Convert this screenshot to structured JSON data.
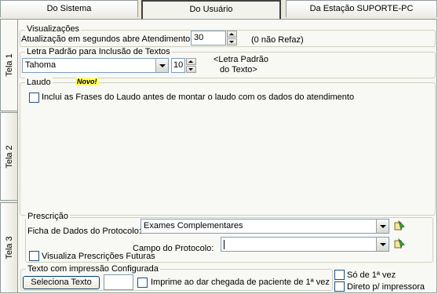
{
  "tabs": [
    {
      "label": "Do Sistema"
    },
    {
      "label": "Do Usuário"
    },
    {
      "label": "Da Estação SUPORTE-PC"
    }
  ],
  "side_tabs": [
    {
      "label": "Tela 1"
    },
    {
      "label": "Tela 2"
    },
    {
      "label": "Tela 3"
    }
  ],
  "visualizacoes": {
    "legend": "Visualizações",
    "label": "Atualização em segundos abre Atendimento:",
    "value": "30",
    "hint": "(0 não Refaz)"
  },
  "letra": {
    "legend": "Letra Padrão para Inclusão de Textos",
    "font_value": "Tahoma",
    "size_value": "10",
    "hint_line1": "<Letra Padrão",
    "hint_line2": "do Texto>"
  },
  "laudo": {
    "legend": "Laudo",
    "badge": "Novo!",
    "checkbox_label": "Inclui as Frases do Laudo antes de montar o laudo com os dados do atendimento"
  },
  "prescricao": {
    "legend": "Prescrição",
    "ficha_label": "Ficha de Dados do Protocolo:",
    "ficha_value": "Exames Complementares",
    "campo_label": "Campo do Protocolo:",
    "campo_value": "",
    "checkbox_label": "Visualiza Prescrições Futuras"
  },
  "impressao": {
    "legend": "Texto com impressão Configurada",
    "button_label": "Seleciona Texto",
    "text_value": "",
    "imprime_label": "Imprime ao dar chegada de paciente de 1ª vez",
    "so_label": "Só de 1ª vez",
    "direto_label": "Direto p/ impressora"
  }
}
